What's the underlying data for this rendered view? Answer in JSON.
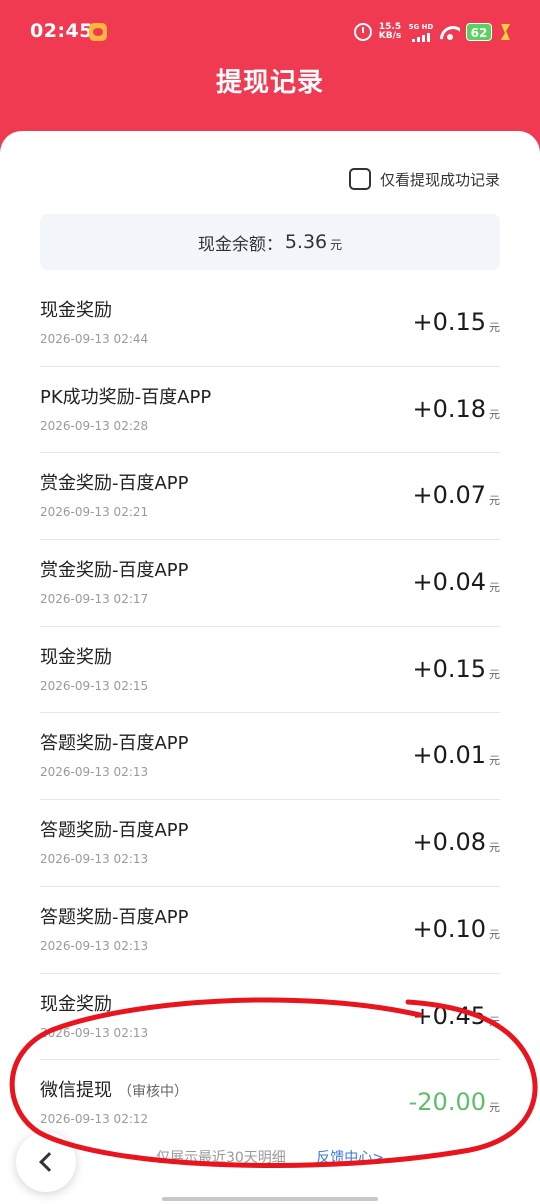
{
  "status_bar": {
    "time": "02:45",
    "net_speed_value": "15.5",
    "net_speed_unit": "KB/s",
    "network_label": "5G HD",
    "battery": "62",
    "icons": [
      "app-notification-icon",
      "alarm-icon",
      "signal-icon",
      "wifi-icon",
      "battery-icon",
      "charging-icon"
    ]
  },
  "header": {
    "title": "提现记录"
  },
  "filter": {
    "label": "仅看提现成功记录",
    "checked": false
  },
  "balance": {
    "label": "现金余额：",
    "value": "5.36",
    "unit": "元"
  },
  "records": [
    {
      "name": "现金奖励",
      "time": "2026-09-13 02:44",
      "amount": "+0.15",
      "unit": "元"
    },
    {
      "name": "PK成功奖励-百度APP",
      "time": "2026-09-13 02:28",
      "amount": "+0.18",
      "unit": "元"
    },
    {
      "name": "赏金奖励-百度APP",
      "time": "2026-09-13 02:21",
      "amount": "+0.07",
      "unit": "元"
    },
    {
      "name": "赏金奖励-百度APP",
      "time": "2026-09-13 02:17",
      "amount": "+0.04",
      "unit": "元"
    },
    {
      "name": "现金奖励",
      "time": "2026-09-13 02:15",
      "amount": "+0.15",
      "unit": "元"
    },
    {
      "name": "答题奖励-百度APP",
      "time": "2026-09-13 02:13",
      "amount": "+0.01",
      "unit": "元"
    },
    {
      "name": "答题奖励-百度APP",
      "time": "2026-09-13 02:13",
      "amount": "+0.08",
      "unit": "元"
    },
    {
      "name": "答题奖励-百度APP",
      "time": "2026-09-13 02:13",
      "amount": "+0.10",
      "unit": "元"
    },
    {
      "name": "现金奖励",
      "time": "2026-09-13 02:13",
      "amount": "+0.45",
      "unit": "元"
    },
    {
      "name": "微信提现",
      "status": "（审核中）",
      "time": "2026-09-13 02:12",
      "amount": "-20.00",
      "unit": "元"
    }
  ],
  "footer": {
    "note": "仅展示最近30天明细",
    "link": "反馈中心>"
  },
  "colors": {
    "header_bg": "#f03a52",
    "withdraw_amount": "#5cbf6a",
    "link": "#3d79d8",
    "annotation": "#e8141e"
  }
}
